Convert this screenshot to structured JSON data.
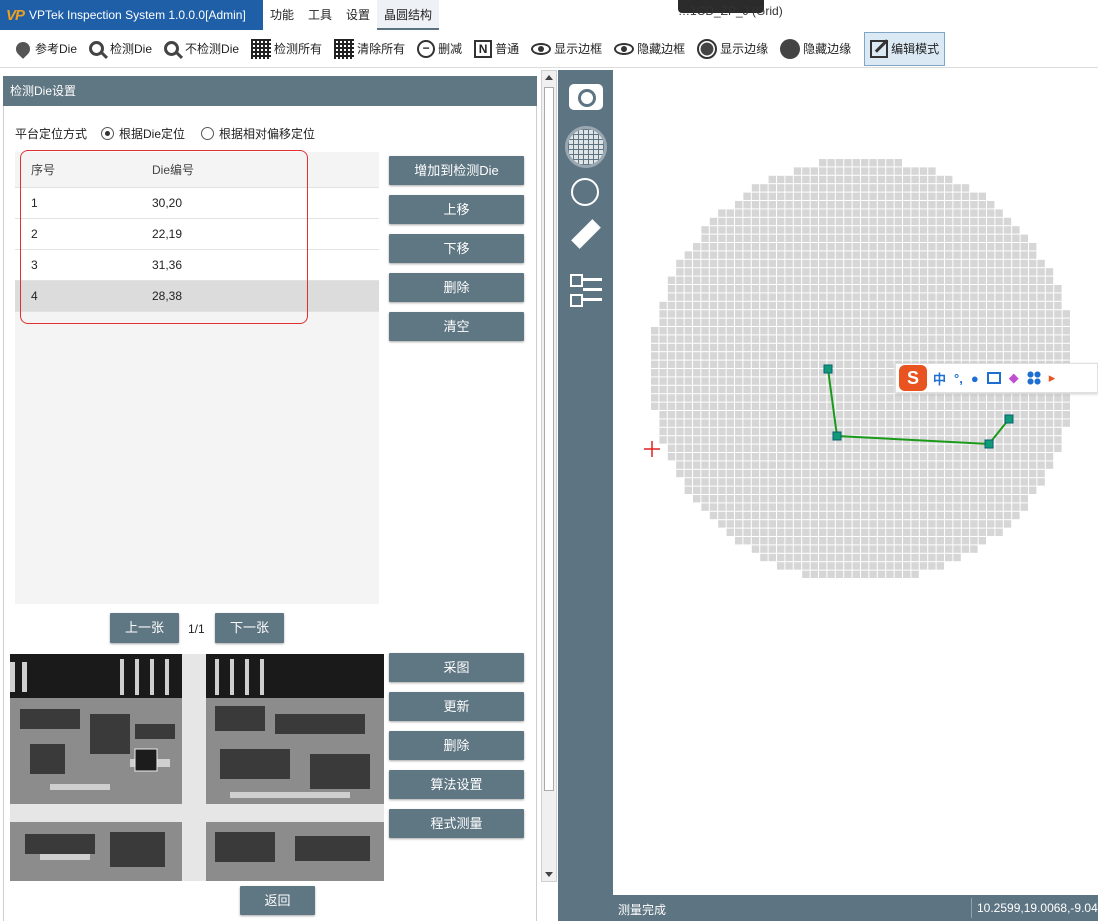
{
  "app": {
    "title": "VPTek Inspection System 1.0.0.0[Admin]",
    "logo_text": "VP",
    "document_title": "…1CD_ZP_J (Grid)"
  },
  "menu": [
    "功能",
    "工具",
    "设置",
    "晶圆结构"
  ],
  "toolbar": [
    {
      "label": "参考Die",
      "icon": "reference-pin-icon"
    },
    {
      "label": "检测Die",
      "icon": "inspect-magnifier-icon"
    },
    {
      "label": "不检测Die",
      "icon": "skip-magnifier-icon"
    },
    {
      "label": "检测所有",
      "icon": "inspect-all-grid-icon"
    },
    {
      "label": "清除所有",
      "icon": "clear-all-grid-icon"
    },
    {
      "label": "删减",
      "icon": "minus-circle-icon"
    },
    {
      "label": "普通",
      "icon": "normal-n-icon"
    },
    {
      "label": "显示边框",
      "icon": "eye-icon"
    },
    {
      "label": "隐藏边框",
      "icon": "eye-slash-icon"
    },
    {
      "label": "显示边缘",
      "icon": "ring-icon"
    },
    {
      "label": "隐藏边缘",
      "icon": "disc-icon"
    },
    {
      "label": "编辑模式",
      "icon": "edit-icon",
      "active": true
    }
  ],
  "panel": {
    "title": "检测Die设置",
    "positioning_label": "平台定位方式",
    "radio_options": [
      {
        "label": "根据Die定位",
        "selected": true
      },
      {
        "label": "根据相对偏移定位",
        "selected": false
      }
    ],
    "table": {
      "headers": [
        "序号",
        "Die编号"
      ],
      "rows": [
        {
          "index": "1",
          "die": "30,20"
        },
        {
          "index": "2",
          "die": "22,19"
        },
        {
          "index": "3",
          "die": "31,36"
        },
        {
          "index": "4",
          "die": "28,38",
          "selected": true
        }
      ]
    },
    "side_buttons": [
      "增加到检测Die",
      "上移",
      "下移",
      "删除",
      "清空"
    ],
    "pager": {
      "prev": "上一张",
      "next": "下一张",
      "page": "1/1"
    },
    "image_buttons": [
      "采图",
      "更新",
      "删除",
      "算法设置",
      "程式测量"
    ],
    "back": "返回"
  },
  "status": {
    "message": "测量完成",
    "coords": "10.2599,19.0068,-9.04"
  },
  "ime": {
    "logo": "S",
    "mode": "中",
    "punct": "°,"
  },
  "colors": {
    "accent": "#5f7683",
    "path": "#1a9a1a",
    "die_marker": "#0f9a7a",
    "origin_cross": "#e02020",
    "die": "#d6d6d6"
  }
}
